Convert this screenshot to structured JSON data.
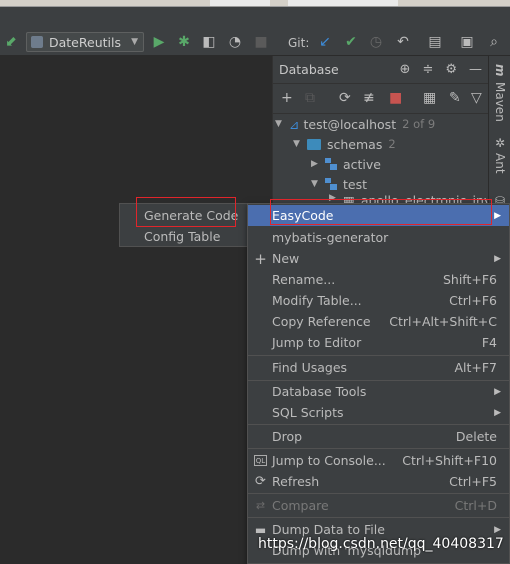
{
  "toolbar": {
    "run_config": "DateReutils",
    "git_label": "Git:"
  },
  "db_panel": {
    "title": "Database",
    "tree": {
      "connection": {
        "label": "test@localhost",
        "count": "2 of 9"
      },
      "schemas": {
        "label": "schemas",
        "count": "2"
      },
      "items": [
        "active",
        "test"
      ],
      "table_partial": "apollo_electronic_inv"
    }
  },
  "sidebar": {
    "maven": "Maven",
    "ant": "Ant"
  },
  "context_menu": {
    "items": [
      {
        "label": "EasyCode",
        "shortcut": "",
        "submenu": true,
        "selected": true
      },
      {
        "label": "mybatis-generator",
        "shortcut": ""
      },
      {
        "label": "New",
        "shortcut": "",
        "submenu": true,
        "icon": "plus-icon"
      },
      {
        "label": "Rename...",
        "shortcut": "Shift+F6"
      },
      {
        "label": "Modify Table...",
        "shortcut": "Ctrl+F6"
      },
      {
        "label": "Copy Reference",
        "shortcut": "Ctrl+Alt+Shift+C"
      },
      {
        "label": "Jump to Editor",
        "shortcut": "F4"
      },
      {
        "label": "Find Usages",
        "shortcut": "Alt+F7"
      },
      {
        "label": "Database Tools",
        "shortcut": "",
        "submenu": true
      },
      {
        "label": "SQL Scripts",
        "shortcut": "",
        "submenu": true
      },
      {
        "label": "Drop",
        "shortcut": "Delete"
      },
      {
        "label": "Jump to Console...",
        "shortcut": "Ctrl+Shift+F10",
        "icon": "console-icon"
      },
      {
        "label": "Refresh",
        "shortcut": "Ctrl+F5",
        "icon": "refresh-icon"
      },
      {
        "label": "Compare",
        "shortcut": "Ctrl+D",
        "disabled": true,
        "icon": "compare-icon"
      },
      {
        "label": "Dump Data to File",
        "shortcut": "",
        "submenu": true,
        "icon": "dump-icon"
      },
      {
        "label": "Dump with 'mysqldump'",
        "shortcut": ""
      }
    ]
  },
  "submenu": {
    "items": [
      "Generate Code",
      "Config Table"
    ]
  },
  "watermark": "https://blog.csdn.net/qq_40408317",
  "colors": {
    "selection": "#4b6eaf",
    "highlight_box": "#e0252b",
    "panel_bg": "#3c3f41",
    "editor_bg": "#2b2b2b"
  }
}
